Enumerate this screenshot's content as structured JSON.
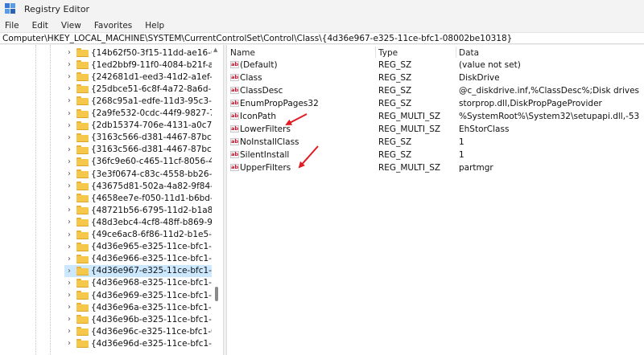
{
  "window": {
    "title": "Registry Editor"
  },
  "menu": {
    "items": [
      "File",
      "Edit",
      "View",
      "Favorites",
      "Help"
    ]
  },
  "address": {
    "path": "Computer\\HKEY_LOCAL_MACHINE\\SYSTEM\\CurrentControlSet\\Control\\Class\\{4d36e967-e325-11ce-bfc1-08002be10318}"
  },
  "tree": {
    "items": [
      {
        "label": "{14b62f50-3f15-11dd-ae16-08002(",
        "selected": false
      },
      {
        "label": "{1ed2bbf9-11f0-4084-b21f-ad83a8",
        "selected": false
      },
      {
        "label": "{242681d1-eed3-41d2-a1ef-1468fc",
        "selected": false
      },
      {
        "label": "{25dbce51-6c8f-4a72-8a6d-b54c2t",
        "selected": false
      },
      {
        "label": "{268c95a1-edfe-11d3-95c3-0010dc",
        "selected": false
      },
      {
        "label": "{2a9fe532-0cdc-44f9-9827-76192f",
        "selected": false
      },
      {
        "label": "{2db15374-706e-4131-a0c7-d7c78",
        "selected": false
      },
      {
        "label": "{3163c566-d381-4467-87bc-a65a1",
        "selected": false
      },
      {
        "label": "{3163c566-d381-4467-87bc-a65a1",
        "selected": false
      },
      {
        "label": "{36fc9e60-c465-11cf-8056-444553",
        "selected": false
      },
      {
        "label": "{3e3f0674-c83c-4558-bb26-9820e",
        "selected": false
      },
      {
        "label": "{43675d81-502a-4a82-9f84-b75f41",
        "selected": false
      },
      {
        "label": "{4658ee7e-f050-11d1-b6bd-00c04",
        "selected": false
      },
      {
        "label": "{48721b56-6795-11d2-b1a8-0080c",
        "selected": false
      },
      {
        "label": "{48d3ebc4-4cf8-48ff-b869-9c68ad",
        "selected": false
      },
      {
        "label": "{49ce6ac8-6f86-11d2-b1e5-0080c7",
        "selected": false
      },
      {
        "label": "{4d36e965-e325-11ce-bfc1-08002b",
        "selected": false
      },
      {
        "label": "{4d36e966-e325-11ce-bfc1-08002b",
        "selected": false
      },
      {
        "label": "{4d36e967-e325-11ce-bfc1-08002b",
        "selected": true
      },
      {
        "label": "{4d36e968-e325-11ce-bfc1-08002b",
        "selected": false
      },
      {
        "label": "{4d36e969-e325-11ce-bfc1-08002b",
        "selected": false
      },
      {
        "label": "{4d36e96a-e325-11ce-bfc1-08002b",
        "selected": false
      },
      {
        "label": "{4d36e96b-e325-11ce-bfc1-08002b",
        "selected": false
      },
      {
        "label": "{4d36e96c-e325-11ce-bfc1-08002b",
        "selected": false
      },
      {
        "label": "{4d36e96d-e325-11ce-bfc1-08002b",
        "selected": false
      }
    ]
  },
  "values_table": {
    "columns": [
      "Name",
      "Type",
      "Data"
    ],
    "rows": [
      {
        "name": "(Default)",
        "type": "REG_SZ",
        "data": "(value not set)"
      },
      {
        "name": "Class",
        "type": "REG_SZ",
        "data": "DiskDrive"
      },
      {
        "name": "ClassDesc",
        "type": "REG_SZ",
        "data": "@c_diskdrive.inf,%ClassDesc%;Disk drives"
      },
      {
        "name": "EnumPropPages32",
        "type": "REG_SZ",
        "data": "storprop.dll,DiskPropPageProvider"
      },
      {
        "name": "IconPath",
        "type": "REG_MULTI_SZ",
        "data": "%SystemRoot%\\System32\\setupapi.dll,-53"
      },
      {
        "name": "LowerFilters",
        "type": "REG_MULTI_SZ",
        "data": "EhStorClass"
      },
      {
        "name": "NoInstallClass",
        "type": "REG_SZ",
        "data": "1"
      },
      {
        "name": "SilentInstall",
        "type": "REG_SZ",
        "data": "1"
      },
      {
        "name": "UpperFilters",
        "type": "REG_MULTI_SZ",
        "data": "partmgr"
      }
    ],
    "value_icon_text": "ab"
  },
  "colors": {
    "selection": "#cce8ff",
    "annotation_arrow": "#e01b24",
    "folder": "#f5c84c"
  },
  "icons": {
    "app": "registry-editor-icon",
    "tree_chevron": "chevron-right-icon",
    "tree_folder": "folder-icon",
    "value": "string-value-icon"
  }
}
